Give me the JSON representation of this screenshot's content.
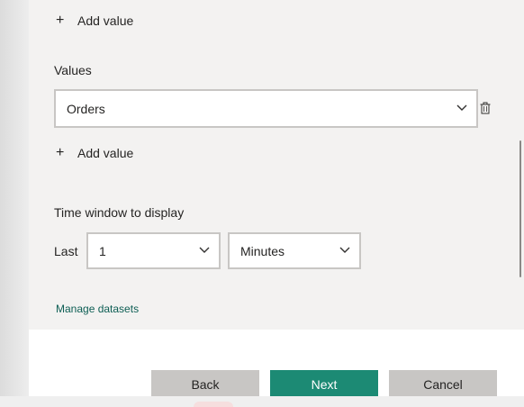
{
  "values_section": {
    "add_value_top": "Add value",
    "label": "Values",
    "selected_value": "Orders",
    "add_value_bottom": "Add value"
  },
  "time_window": {
    "label": "Time window to display",
    "last_label": "Last",
    "amount": "1",
    "unit": "Minutes"
  },
  "links": {
    "manage_datasets": "Manage datasets"
  },
  "footer": {
    "back": "Back",
    "next": "Next",
    "cancel": "Cancel"
  },
  "icons": {
    "plus": "+",
    "chevron": "chevron-down-icon",
    "trash": "trash-icon"
  },
  "colors": {
    "primary": "#1c8a74",
    "link": "#0d5e54",
    "panel": "#f3f2f1"
  }
}
